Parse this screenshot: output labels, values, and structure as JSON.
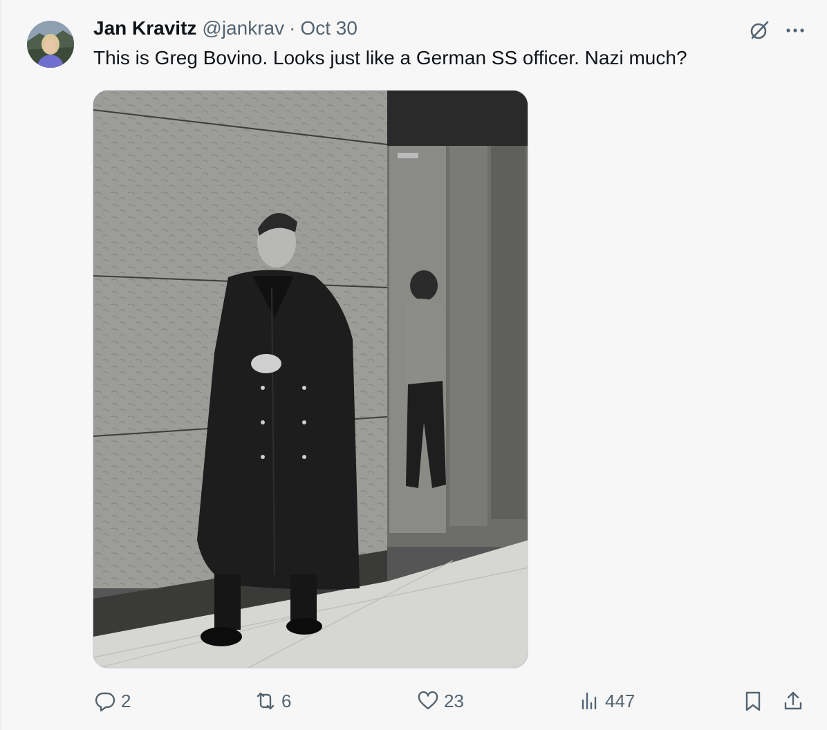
{
  "author": {
    "name": "Jan Kravitz",
    "handle": "@jankrav",
    "separator": "·",
    "date": "Oct 30"
  },
  "tweet": {
    "text": "This is Greg Bovino. Looks just like a German SS officer. Nazi much?"
  },
  "media": {
    "kind": "photo",
    "description_colors": {
      "wall": "#9a9a96",
      "floor": "#d8d8d4",
      "coat": "#1c1c1c"
    }
  },
  "actions": {
    "replies": "2",
    "reposts": "6",
    "likes": "23",
    "views": "447"
  },
  "icons": {
    "grok": "grok-icon",
    "more": "more-icon",
    "reply": "reply-icon",
    "retweet": "retweet-icon",
    "like": "heart-icon",
    "views": "views-icon",
    "bookmark": "bookmark-icon",
    "share": "share-icon"
  },
  "colors": {
    "text": "#0f1419",
    "secondary": "#536471",
    "background": "#f7f7f7",
    "border": "#cfd9de"
  }
}
